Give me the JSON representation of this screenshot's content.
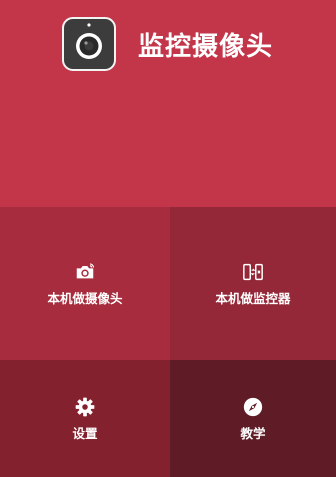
{
  "header": {
    "title": "监控摄像头",
    "app_icon": "camera-lens-icon"
  },
  "tiles": [
    {
      "label": "本机做摄像头",
      "icon": "camera-icon"
    },
    {
      "label": "本机做监控器",
      "icon": "phone-pair-icon"
    },
    {
      "label": "设置",
      "icon": "gear-icon"
    },
    {
      "label": "教学",
      "icon": "compass-icon"
    }
  ],
  "colors": {
    "hero": "#c3364a",
    "tile_camera": "#a72c3d",
    "tile_monitor": "#952838",
    "tile_settings": "#84212e",
    "tile_teaching": "#5f1c26",
    "text": "#ffffff"
  }
}
